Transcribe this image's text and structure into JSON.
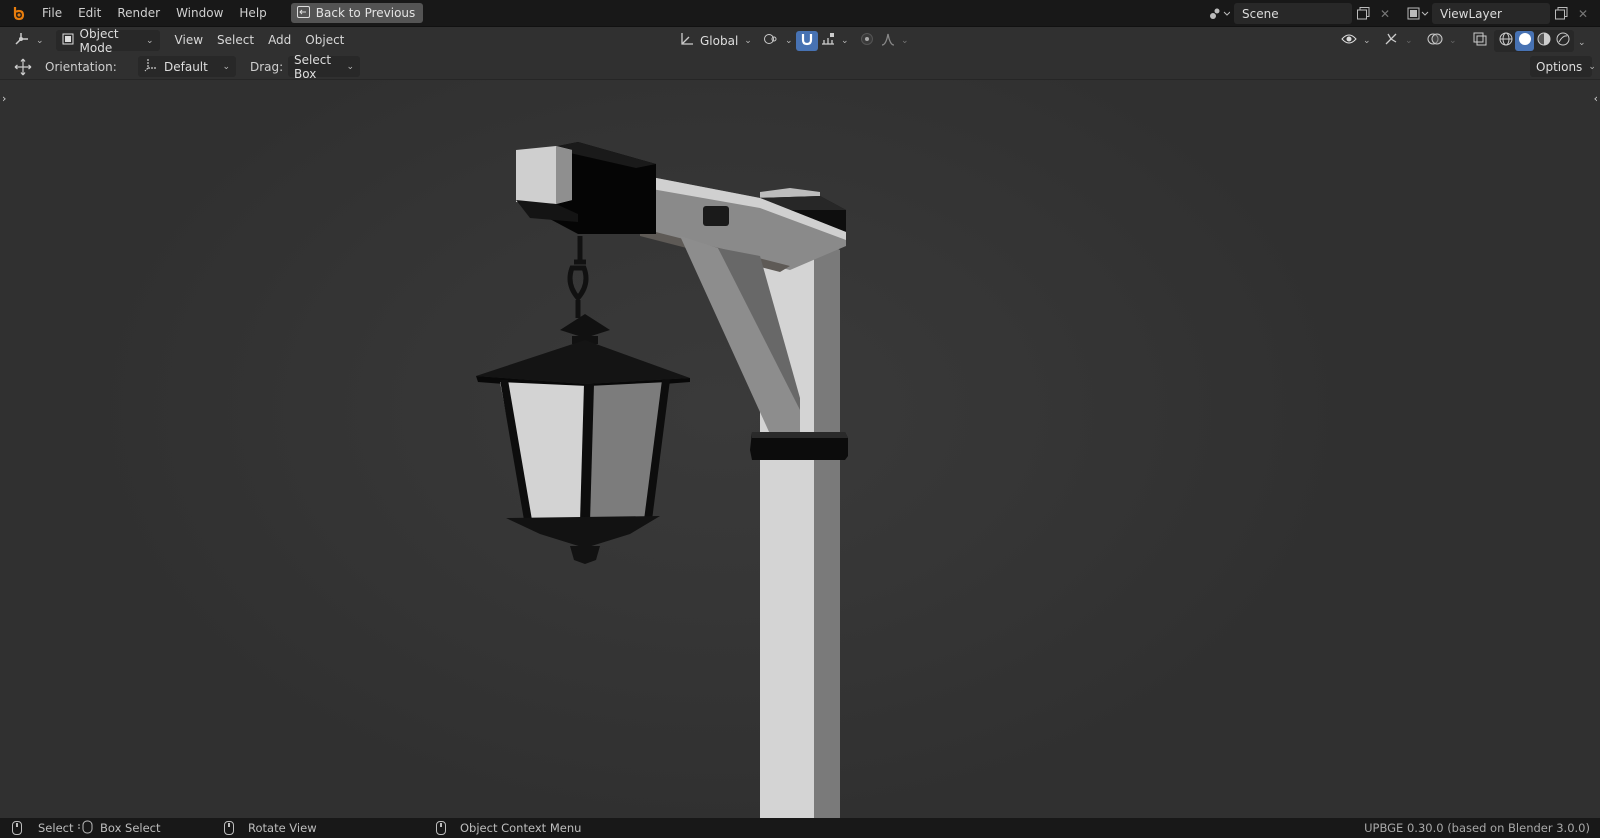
{
  "menubar": {
    "items": [
      "File",
      "Edit",
      "Render",
      "Window",
      "Help"
    ],
    "back_button": "Back to Previous",
    "scene_name": "Scene",
    "view_layer_name": "ViewLayer"
  },
  "header": {
    "mode": "Object Mode",
    "menus": [
      "View",
      "Select",
      "Add",
      "Object"
    ],
    "transform_orientation": "Global"
  },
  "toolbar": {
    "orientation_label": "Orientation:",
    "orientation_value": "Default",
    "drag_label": "Drag:",
    "drag_value": "Select Box",
    "options_label": "Options"
  },
  "statusbar": {
    "select": "Select",
    "box_select": "Box Select",
    "rotate_view": "Rotate View",
    "context_menu": "Object Context Menu",
    "version": "UPBGE 0.30.0 (based on Blender 3.0.0)"
  },
  "colors": {
    "accent": "#4772b3",
    "bg_header": "#303030",
    "bg_topbar": "#181818"
  }
}
